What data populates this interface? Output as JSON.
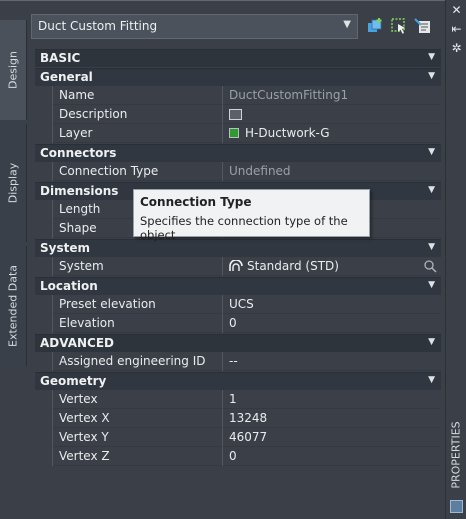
{
  "side_tabs": [
    "Design",
    "Display",
    "Extended Data"
  ],
  "header": {
    "selected_type": "Duct Custom Fitting"
  },
  "right_bar": {
    "label": "PROPERTIES"
  },
  "icons": [
    "close-icon",
    "auto-hide-icon",
    "settings-icon",
    "add-style-icon",
    "select-objects-icon",
    "edit-style-icon",
    "field-icon",
    "system-icon",
    "search-icon"
  ],
  "colors": {
    "layer_swatch": "#2f9c2f",
    "tooltip_bg": "#f1f2f4",
    "panel_bg": "#3b4048"
  },
  "sections": {
    "basic": "BASIC",
    "general": "General",
    "connectors": "Connectors",
    "dimensions": "Dimensions",
    "system": "System",
    "location": "Location",
    "advanced": "ADVANCED",
    "geometry": "Geometry"
  },
  "props": {
    "name": {
      "label": "Name",
      "value": "DuctCustomFitting1"
    },
    "description": {
      "label": "Description"
    },
    "layer": {
      "label": "Layer",
      "value": "H-Ductwork-G"
    },
    "connection_type": {
      "label": "Connection Type",
      "value": "Undefined"
    },
    "length": {
      "label": "Length"
    },
    "shape": {
      "label": "Shape"
    },
    "system": {
      "label": "System",
      "value": "Standard (STD)"
    },
    "preset_elevation": {
      "label": "Preset elevation",
      "value": "UCS"
    },
    "elevation": {
      "label": "Elevation",
      "value": "0"
    },
    "engineering_id": {
      "label": "Assigned engineering ID",
      "value": "--"
    },
    "vertex": {
      "label": "Vertex",
      "value": "1"
    },
    "vertex_x": {
      "label": "Vertex X",
      "value": "13248"
    },
    "vertex_y": {
      "label": "Vertex Y",
      "value": "46077"
    },
    "vertex_z": {
      "label": "Vertex Z",
      "value": "0"
    }
  },
  "tooltip": {
    "title": "Connection Type",
    "description": "Specifies the connection type of the object"
  }
}
